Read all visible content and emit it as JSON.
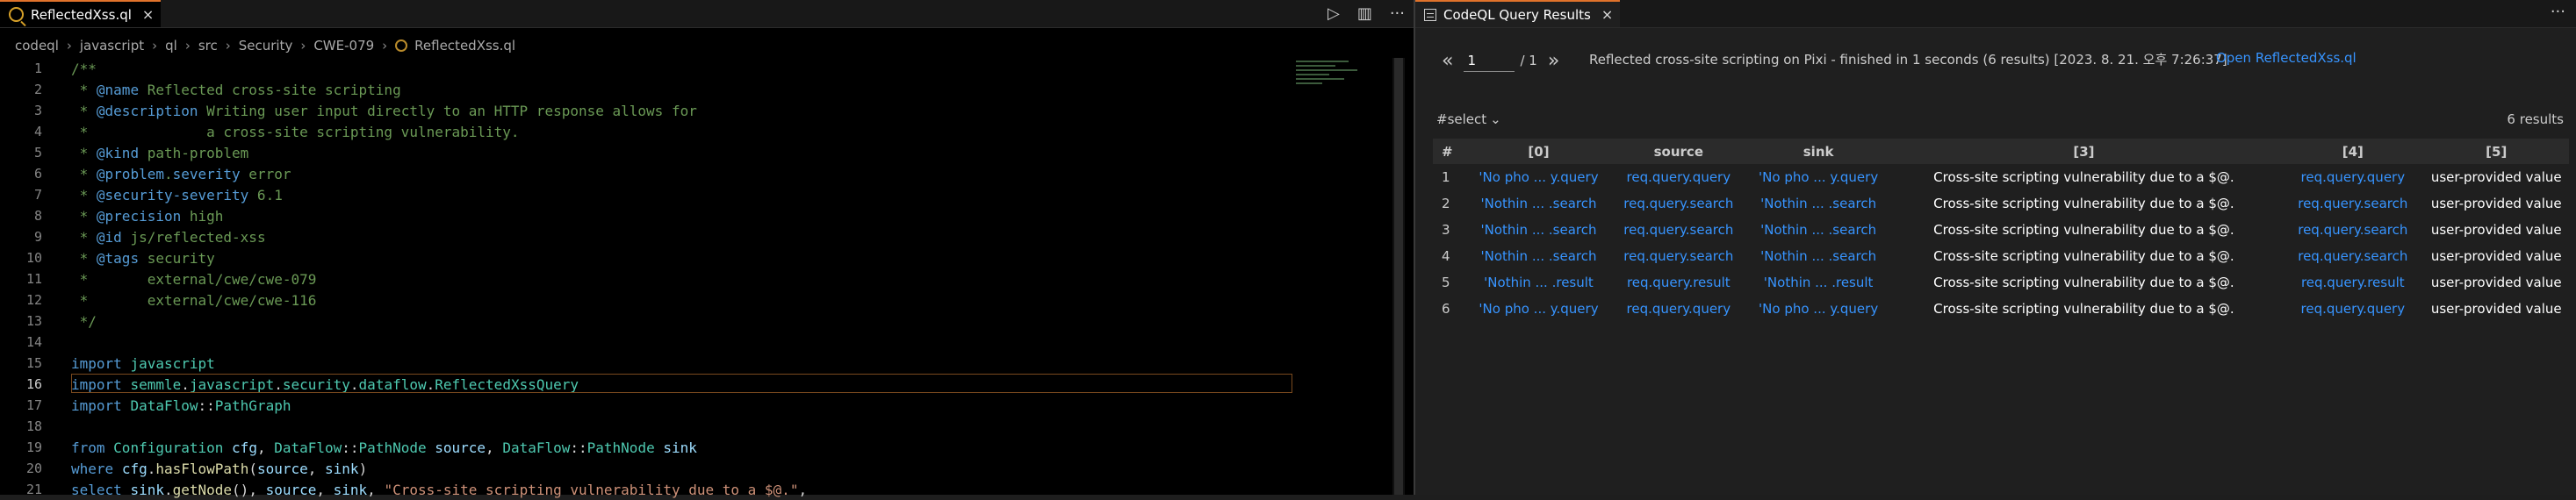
{
  "editor": {
    "tab": {
      "label": "ReflectedXss.ql",
      "close": "×"
    },
    "toolbar": {
      "run": "▷",
      "split": "▥",
      "more": "···"
    },
    "breadcrumb": [
      "codeql",
      "javascript",
      "ql",
      "src",
      "Security",
      "CWE-079",
      "ReflectedXss.ql"
    ],
    "current_line": 16,
    "lines": [
      {
        "n": 1,
        "parts": [
          [
            "c-com",
            "/**"
          ]
        ]
      },
      {
        "n": 2,
        "parts": [
          [
            "c-com",
            " * "
          ],
          [
            "c-tag",
            "@name"
          ],
          [
            "c-com",
            " Reflected cross-site scripting"
          ]
        ]
      },
      {
        "n": 3,
        "parts": [
          [
            "c-com",
            " * "
          ],
          [
            "c-tag",
            "@description"
          ],
          [
            "c-com",
            " Writing user input directly to an HTTP response allows for"
          ]
        ]
      },
      {
        "n": 4,
        "parts": [
          [
            "c-com",
            " *              a cross-site scripting vulnerability."
          ]
        ]
      },
      {
        "n": 5,
        "parts": [
          [
            "c-com",
            " * "
          ],
          [
            "c-tag",
            "@kind"
          ],
          [
            "c-com",
            " path-problem"
          ]
        ]
      },
      {
        "n": 6,
        "parts": [
          [
            "c-com",
            " * "
          ],
          [
            "c-tag",
            "@problem"
          ],
          [
            "c-com",
            "."
          ],
          [
            "c-tag",
            "severity"
          ],
          [
            "c-com",
            " error"
          ]
        ]
      },
      {
        "n": 7,
        "parts": [
          [
            "c-com",
            " * "
          ],
          [
            "c-tag",
            "@security-severity"
          ],
          [
            "c-com",
            " 6.1"
          ]
        ]
      },
      {
        "n": 8,
        "parts": [
          [
            "c-com",
            " * "
          ],
          [
            "c-tag",
            "@precision"
          ],
          [
            "c-com",
            " high"
          ]
        ]
      },
      {
        "n": 9,
        "parts": [
          [
            "c-com",
            " * "
          ],
          [
            "c-tag",
            "@id"
          ],
          [
            "c-com",
            " js/reflected-xss"
          ]
        ]
      },
      {
        "n": 10,
        "parts": [
          [
            "c-com",
            " * "
          ],
          [
            "c-tag",
            "@tags"
          ],
          [
            "c-com",
            " security"
          ]
        ]
      },
      {
        "n": 11,
        "parts": [
          [
            "c-com",
            " *       external/cwe/cwe-079"
          ]
        ]
      },
      {
        "n": 12,
        "parts": [
          [
            "c-com",
            " *       external/cwe/cwe-116"
          ]
        ]
      },
      {
        "n": 13,
        "parts": [
          [
            "c-com",
            " */"
          ]
        ]
      },
      {
        "n": 14,
        "parts": []
      },
      {
        "n": 15,
        "parts": [
          [
            "c-kw",
            "import"
          ],
          [
            "c-plain",
            " "
          ],
          [
            "c-ty",
            "javascript"
          ]
        ]
      },
      {
        "n": 16,
        "parts": [
          [
            "c-kw",
            "import"
          ],
          [
            "c-plain",
            " "
          ],
          [
            "c-ty",
            "semmle"
          ],
          [
            "c-plain",
            "."
          ],
          [
            "c-ty",
            "javascript"
          ],
          [
            "c-plain",
            "."
          ],
          [
            "c-ty",
            "security"
          ],
          [
            "c-plain",
            "."
          ],
          [
            "c-ty",
            "dataflow"
          ],
          [
            "c-plain",
            "."
          ],
          [
            "c-ty",
            "ReflectedXssQuery"
          ]
        ]
      },
      {
        "n": 17,
        "parts": [
          [
            "c-kw",
            "import"
          ],
          [
            "c-plain",
            " "
          ],
          [
            "c-ty",
            "DataFlow"
          ],
          [
            "c-plain",
            "::"
          ],
          [
            "c-ty",
            "PathGraph"
          ]
        ]
      },
      {
        "n": 18,
        "parts": []
      },
      {
        "n": 19,
        "parts": [
          [
            "c-kw",
            "from"
          ],
          [
            "c-plain",
            " "
          ],
          [
            "c-ty",
            "Configuration"
          ],
          [
            "c-plain",
            " "
          ],
          [
            "c-var",
            "cfg"
          ],
          [
            "c-plain",
            ", "
          ],
          [
            "c-ty",
            "DataFlow"
          ],
          [
            "c-plain",
            "::"
          ],
          [
            "c-ty",
            "PathNode"
          ],
          [
            "c-plain",
            " "
          ],
          [
            "c-var",
            "source"
          ],
          [
            "c-plain",
            ", "
          ],
          [
            "c-ty",
            "DataFlow"
          ],
          [
            "c-plain",
            "::"
          ],
          [
            "c-ty",
            "PathNode"
          ],
          [
            "c-plain",
            " "
          ],
          [
            "c-var",
            "sink"
          ]
        ]
      },
      {
        "n": 20,
        "parts": [
          [
            "c-kw",
            "where"
          ],
          [
            "c-plain",
            " "
          ],
          [
            "c-var",
            "cfg"
          ],
          [
            "c-plain",
            "."
          ],
          [
            "c-fn",
            "hasFlowPath"
          ],
          [
            "c-plain",
            "("
          ],
          [
            "c-var",
            "source"
          ],
          [
            "c-plain",
            ", "
          ],
          [
            "c-var",
            "sink"
          ],
          [
            "c-plain",
            ")"
          ]
        ]
      },
      {
        "n": 21,
        "parts": [
          [
            "c-kw",
            "select"
          ],
          [
            "c-plain",
            " "
          ],
          [
            "c-var",
            "sink"
          ],
          [
            "c-plain",
            "."
          ],
          [
            "c-fn",
            "getNode"
          ],
          [
            "c-plain",
            "(), "
          ],
          [
            "c-var",
            "source"
          ],
          [
            "c-plain",
            ", "
          ],
          [
            "c-var",
            "sink"
          ],
          [
            "c-plain",
            ", "
          ],
          [
            "c-str",
            "\"Cross-site scripting vulnerability due to a $@.\""
          ],
          [
            "c-plain",
            ","
          ]
        ]
      }
    ]
  },
  "results": {
    "tab": {
      "label": "CodeQL Query Results",
      "close": "×"
    },
    "more": "···",
    "pager": {
      "prev": "«",
      "page": "1",
      "total": "/ 1",
      "next": "»"
    },
    "summary": "Reflected cross-site scripting on Pixi - finished in 1 seconds (6 results) [2023. 8. 21. 오후 7:26:37]",
    "open_link": "Open ReflectedXss.ql",
    "select_label": "#select",
    "result_count": "6 results",
    "columns": [
      "#",
      "[0]",
      "source",
      "sink",
      "[3]",
      "[4]",
      "[5]"
    ],
    "rows": [
      [
        "1",
        "'No pho ... y.query",
        "req.query.query",
        "'No pho ... y.query",
        "Cross-site scripting vulnerability due to a $@.",
        "req.query.query",
        "user-provided value"
      ],
      [
        "2",
        "'Nothin ... .search",
        "req.query.search",
        "'Nothin ... .search",
        "Cross-site scripting vulnerability due to a $@.",
        "req.query.search",
        "user-provided value"
      ],
      [
        "3",
        "'Nothin ... .search",
        "req.query.search",
        "'Nothin ... .search",
        "Cross-site scripting vulnerability due to a $@.",
        "req.query.search",
        "user-provided value"
      ],
      [
        "4",
        "'Nothin ... .search",
        "req.query.search",
        "'Nothin ... .search",
        "Cross-site scripting vulnerability due to a $@.",
        "req.query.search",
        "user-provided value"
      ],
      [
        "5",
        "'Nothin ... .result",
        "req.query.result",
        "'Nothin ... .result",
        "Cross-site scripting vulnerability due to a $@.",
        "req.query.result",
        "user-provided value"
      ],
      [
        "6",
        "'No pho ... y.query",
        "req.query.query",
        "'No pho ... y.query",
        "Cross-site scripting vulnerability due to a $@.",
        "req.query.query",
        "user-provided value"
      ]
    ]
  },
  "colors": {
    "accent": "#e0722b",
    "link": "#3794ff",
    "comment": "#6a9955",
    "keyword": "#569cd6",
    "type": "#4ec9b0"
  }
}
